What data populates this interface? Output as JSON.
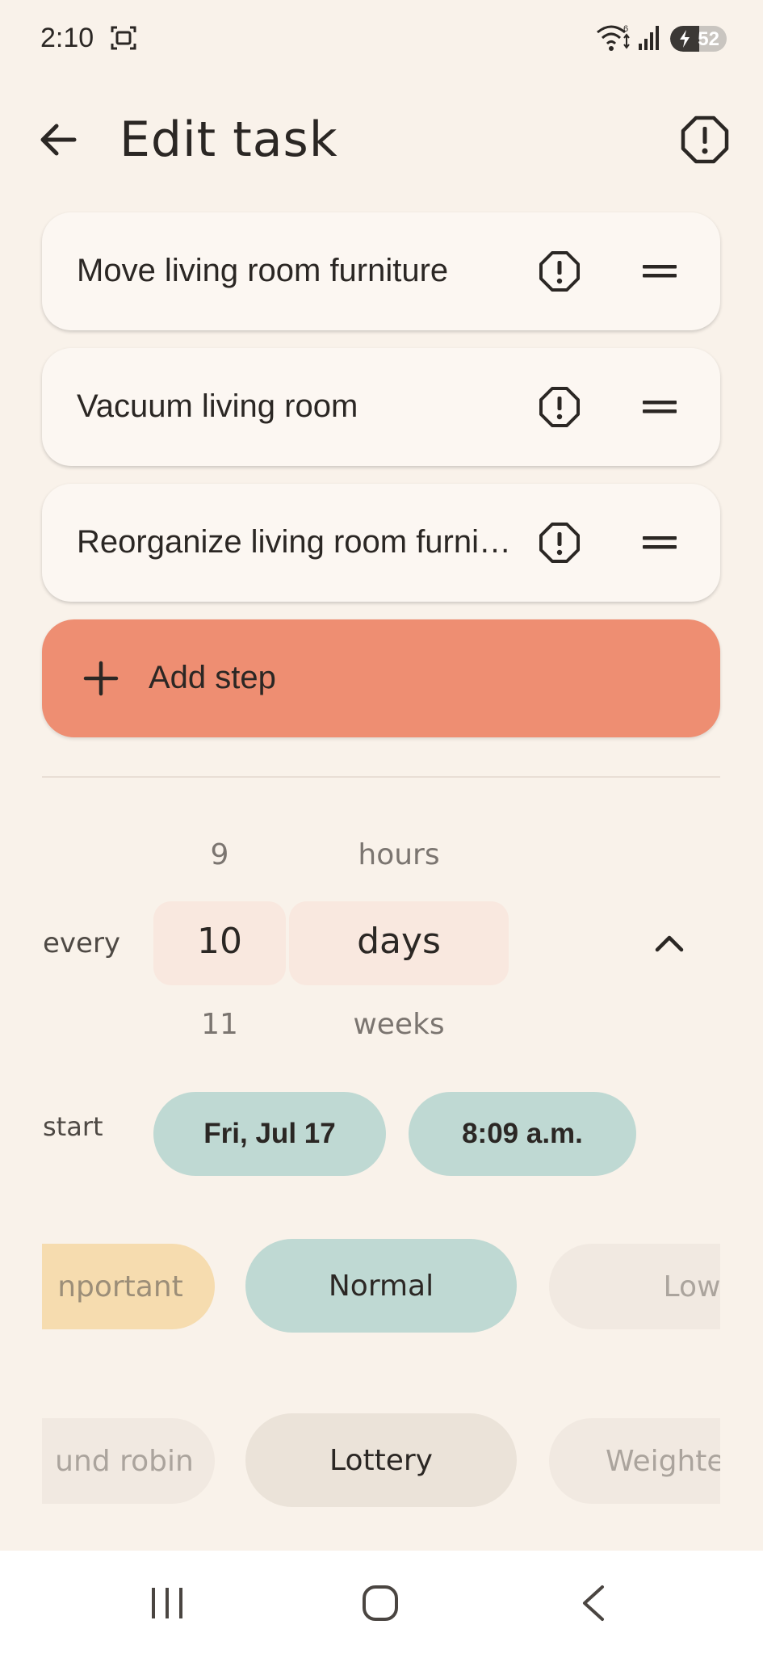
{
  "status_bar": {
    "time": "2:10",
    "battery_level": 52,
    "battery_label": "52",
    "icons": [
      "screenshot-icon",
      "wifi-icon",
      "signal-icon",
      "battery-charging-icon"
    ]
  },
  "app_bar": {
    "title": "Edit task",
    "back_icon": "arrow-left-icon",
    "priority_icon": "alert-octagon-icon"
  },
  "steps": [
    {
      "label": "Move living room furniture"
    },
    {
      "label": "Vacuum living room"
    },
    {
      "label": "Reorganize living room furniture"
    }
  ],
  "add_step": {
    "label": "Add step",
    "icon": "plus-icon"
  },
  "interval": {
    "label": "every",
    "numbers": {
      "prev": "9",
      "selected": "10",
      "next": "11"
    },
    "units": {
      "prev": "hours",
      "selected": "days",
      "next": "weeks"
    }
  },
  "start": {
    "label": "start",
    "date": "Fri, Jul 17",
    "time": "8:09 a.m."
  },
  "priority_options": {
    "items": [
      "Important",
      "Normal",
      "Low"
    ],
    "visible": [
      "nportant",
      "Normal",
      "Low"
    ],
    "selected": "Normal"
  },
  "schedule_options": {
    "items": [
      "Round robin",
      "Lottery",
      "Weighted"
    ],
    "visible": [
      "und robin",
      "Lottery",
      "Weighte"
    ],
    "selected": "Lottery"
  },
  "colors": {
    "background": "#f9f2ea",
    "card": "#fcf7f2",
    "accent": "#ee8e72",
    "teal": "#bfd9d3",
    "amber": "#f6dcaf"
  }
}
